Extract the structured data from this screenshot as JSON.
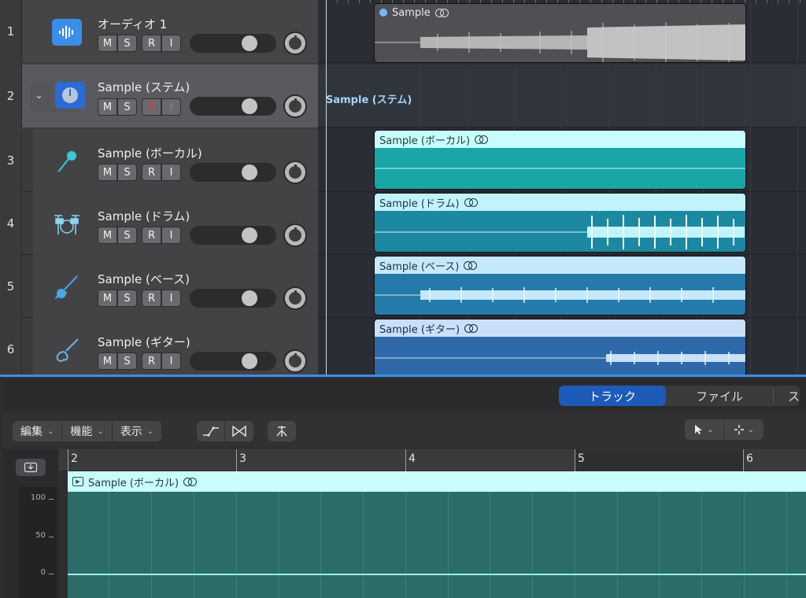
{
  "tracks": [
    {
      "number": "1",
      "name": "オーディオ 1",
      "buttons": {
        "m": "M",
        "s": "S",
        "r": "R",
        "i": "I"
      },
      "icon": "waveform-icon"
    },
    {
      "number": "2",
      "name": "Sample (ステム)",
      "buttons": {
        "m": "M",
        "s": "S",
        "r": "R",
        "i": "I"
      },
      "icon": "stem-stack-icon"
    },
    {
      "number": "3",
      "name": "Sample (ボーカル)",
      "buttons": {
        "m": "M",
        "s": "S",
        "r": "R",
        "i": "I"
      },
      "icon": "microphone-icon"
    },
    {
      "number": "4",
      "name": "Sample (ドラム)",
      "buttons": {
        "m": "M",
        "s": "S",
        "r": "R",
        "i": "I"
      },
      "icon": "drum-kit-icon"
    },
    {
      "number": "5",
      "name": "Sample (ベース)",
      "buttons": {
        "m": "M",
        "s": "S",
        "r": "R",
        "i": "I"
      },
      "icon": "bass-guitar-icon"
    },
    {
      "number": "6",
      "name": "Sample (ギター)",
      "buttons": {
        "m": "M",
        "s": "S",
        "r": "R",
        "i": "I"
      },
      "icon": "electric-guitar-icon"
    }
  ],
  "arrange": {
    "stem_label": "Sample (ステム)",
    "regions": [
      {
        "name": "Sample"
      },
      {
        "name": "Sample (ボーカル)"
      },
      {
        "name": "Sample (ドラム)"
      },
      {
        "name": "Sample (ベース)"
      },
      {
        "name": "Sample (ギター)"
      }
    ]
  },
  "editor": {
    "tabs": [
      "トラック",
      "ファイル",
      "ス"
    ],
    "menus": [
      "編集",
      "機能",
      "表示"
    ],
    "ruler_bars": [
      "2",
      "3",
      "4",
      "5",
      "6"
    ],
    "scale_labels": [
      "100",
      "50",
      "0"
    ],
    "region_name": "Sample (ボーカル)"
  },
  "colors": {
    "accent": "#3a8ee6",
    "vocal_region": "#1aa6a6",
    "drum_region": "#1d88a2",
    "bass_region": "#247aa8",
    "guitar_region": "#2f68a8",
    "editor_region": "#2b6b68"
  }
}
